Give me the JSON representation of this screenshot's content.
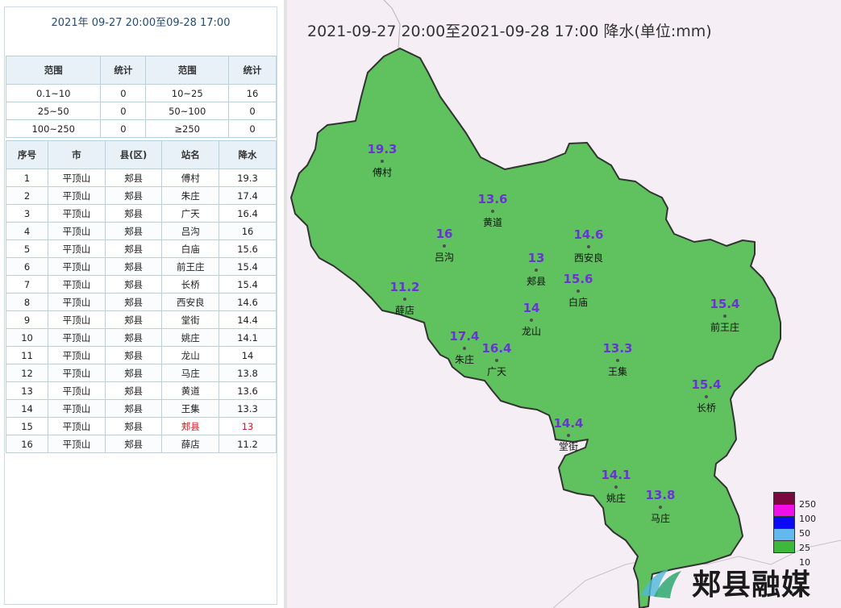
{
  "left_panel": {
    "period": "2021年 09-27 20:00至09-28 17:00",
    "stats_headers": [
      "范围",
      "统计",
      "范围",
      "统计"
    ],
    "stats_rows": [
      [
        "0.1~10",
        "0",
        "10~25",
        "16"
      ],
      [
        "25~50",
        "0",
        "50~100",
        "0"
      ],
      [
        "100~250",
        "0",
        "≥250",
        "0"
      ]
    ],
    "station_headers": [
      "序号",
      "市",
      "县(区)",
      "站名",
      "降水"
    ],
    "stations": [
      [
        "1",
        "平顶山",
        "郏县",
        "傅村",
        "19.3"
      ],
      [
        "2",
        "平顶山",
        "郏县",
        "朱庄",
        "17.4"
      ],
      [
        "3",
        "平顶山",
        "郏县",
        "广天",
        "16.4"
      ],
      [
        "4",
        "平顶山",
        "郏县",
        "吕沟",
        "16"
      ],
      [
        "5",
        "平顶山",
        "郏县",
        "白庙",
        "15.6"
      ],
      [
        "6",
        "平顶山",
        "郏县",
        "前王庄",
        "15.4"
      ],
      [
        "7",
        "平顶山",
        "郏县",
        "长桥",
        "15.4"
      ],
      [
        "8",
        "平顶山",
        "郏县",
        "西安良",
        "14.6"
      ],
      [
        "9",
        "平顶山",
        "郏县",
        "堂街",
        "14.4"
      ],
      [
        "10",
        "平顶山",
        "郏县",
        "姚庄",
        "14.1"
      ],
      [
        "11",
        "平顶山",
        "郏县",
        "龙山",
        "14"
      ],
      [
        "12",
        "平顶山",
        "郏县",
        "马庄",
        "13.8"
      ],
      [
        "13",
        "平顶山",
        "郏县",
        "黄道",
        "13.6"
      ],
      [
        "14",
        "平顶山",
        "郏县",
        "王集",
        "13.3"
      ],
      [
        "15",
        "平顶山",
        "郏县",
        "郏县",
        "13"
      ],
      [
        "16",
        "平顶山",
        "郏县",
        "薛店",
        "11.2"
      ]
    ],
    "highlight_row": 15,
    "highlight_color": "#d0191e"
  },
  "map": {
    "title": "2021-09-27 20:00至2021-09-28 17:00 降水(单位:mm)",
    "fill_color": "#5fc25f",
    "background": "#f5eef4",
    "labels": [
      {
        "name": "傅村",
        "value": "19.3"
      },
      {
        "name": "黄道",
        "value": "13.6"
      },
      {
        "name": "吕沟",
        "value": "16"
      },
      {
        "name": "西安良",
        "value": "14.6"
      },
      {
        "name": "郏县",
        "value": "13"
      },
      {
        "name": "白庙",
        "value": "15.6"
      },
      {
        "name": "薛店",
        "value": "11.2"
      },
      {
        "name": "龙山",
        "value": "14"
      },
      {
        "name": "前王庄",
        "value": "15.4"
      },
      {
        "name": "朱庄",
        "value": "17.4"
      },
      {
        "name": "广天",
        "value": "16.4"
      },
      {
        "name": "王集",
        "value": "13.3"
      },
      {
        "name": "长桥",
        "value": "15.4"
      },
      {
        "name": "堂街",
        "value": "14.4"
      },
      {
        "name": "姚庄",
        "value": "14.1"
      },
      {
        "name": "马庄",
        "value": "13.8"
      }
    ],
    "legend": [
      {
        "label": "250",
        "color": "#7a0a3e"
      },
      {
        "label": "100",
        "color": "#f00fe9"
      },
      {
        "label": "50",
        "color": "#0a0af5"
      },
      {
        "label": "25",
        "color": "#63b8ee"
      },
      {
        "label": "10",
        "color": "#3db83d"
      }
    ]
  },
  "watermark": {
    "text": "郏县融媒"
  }
}
